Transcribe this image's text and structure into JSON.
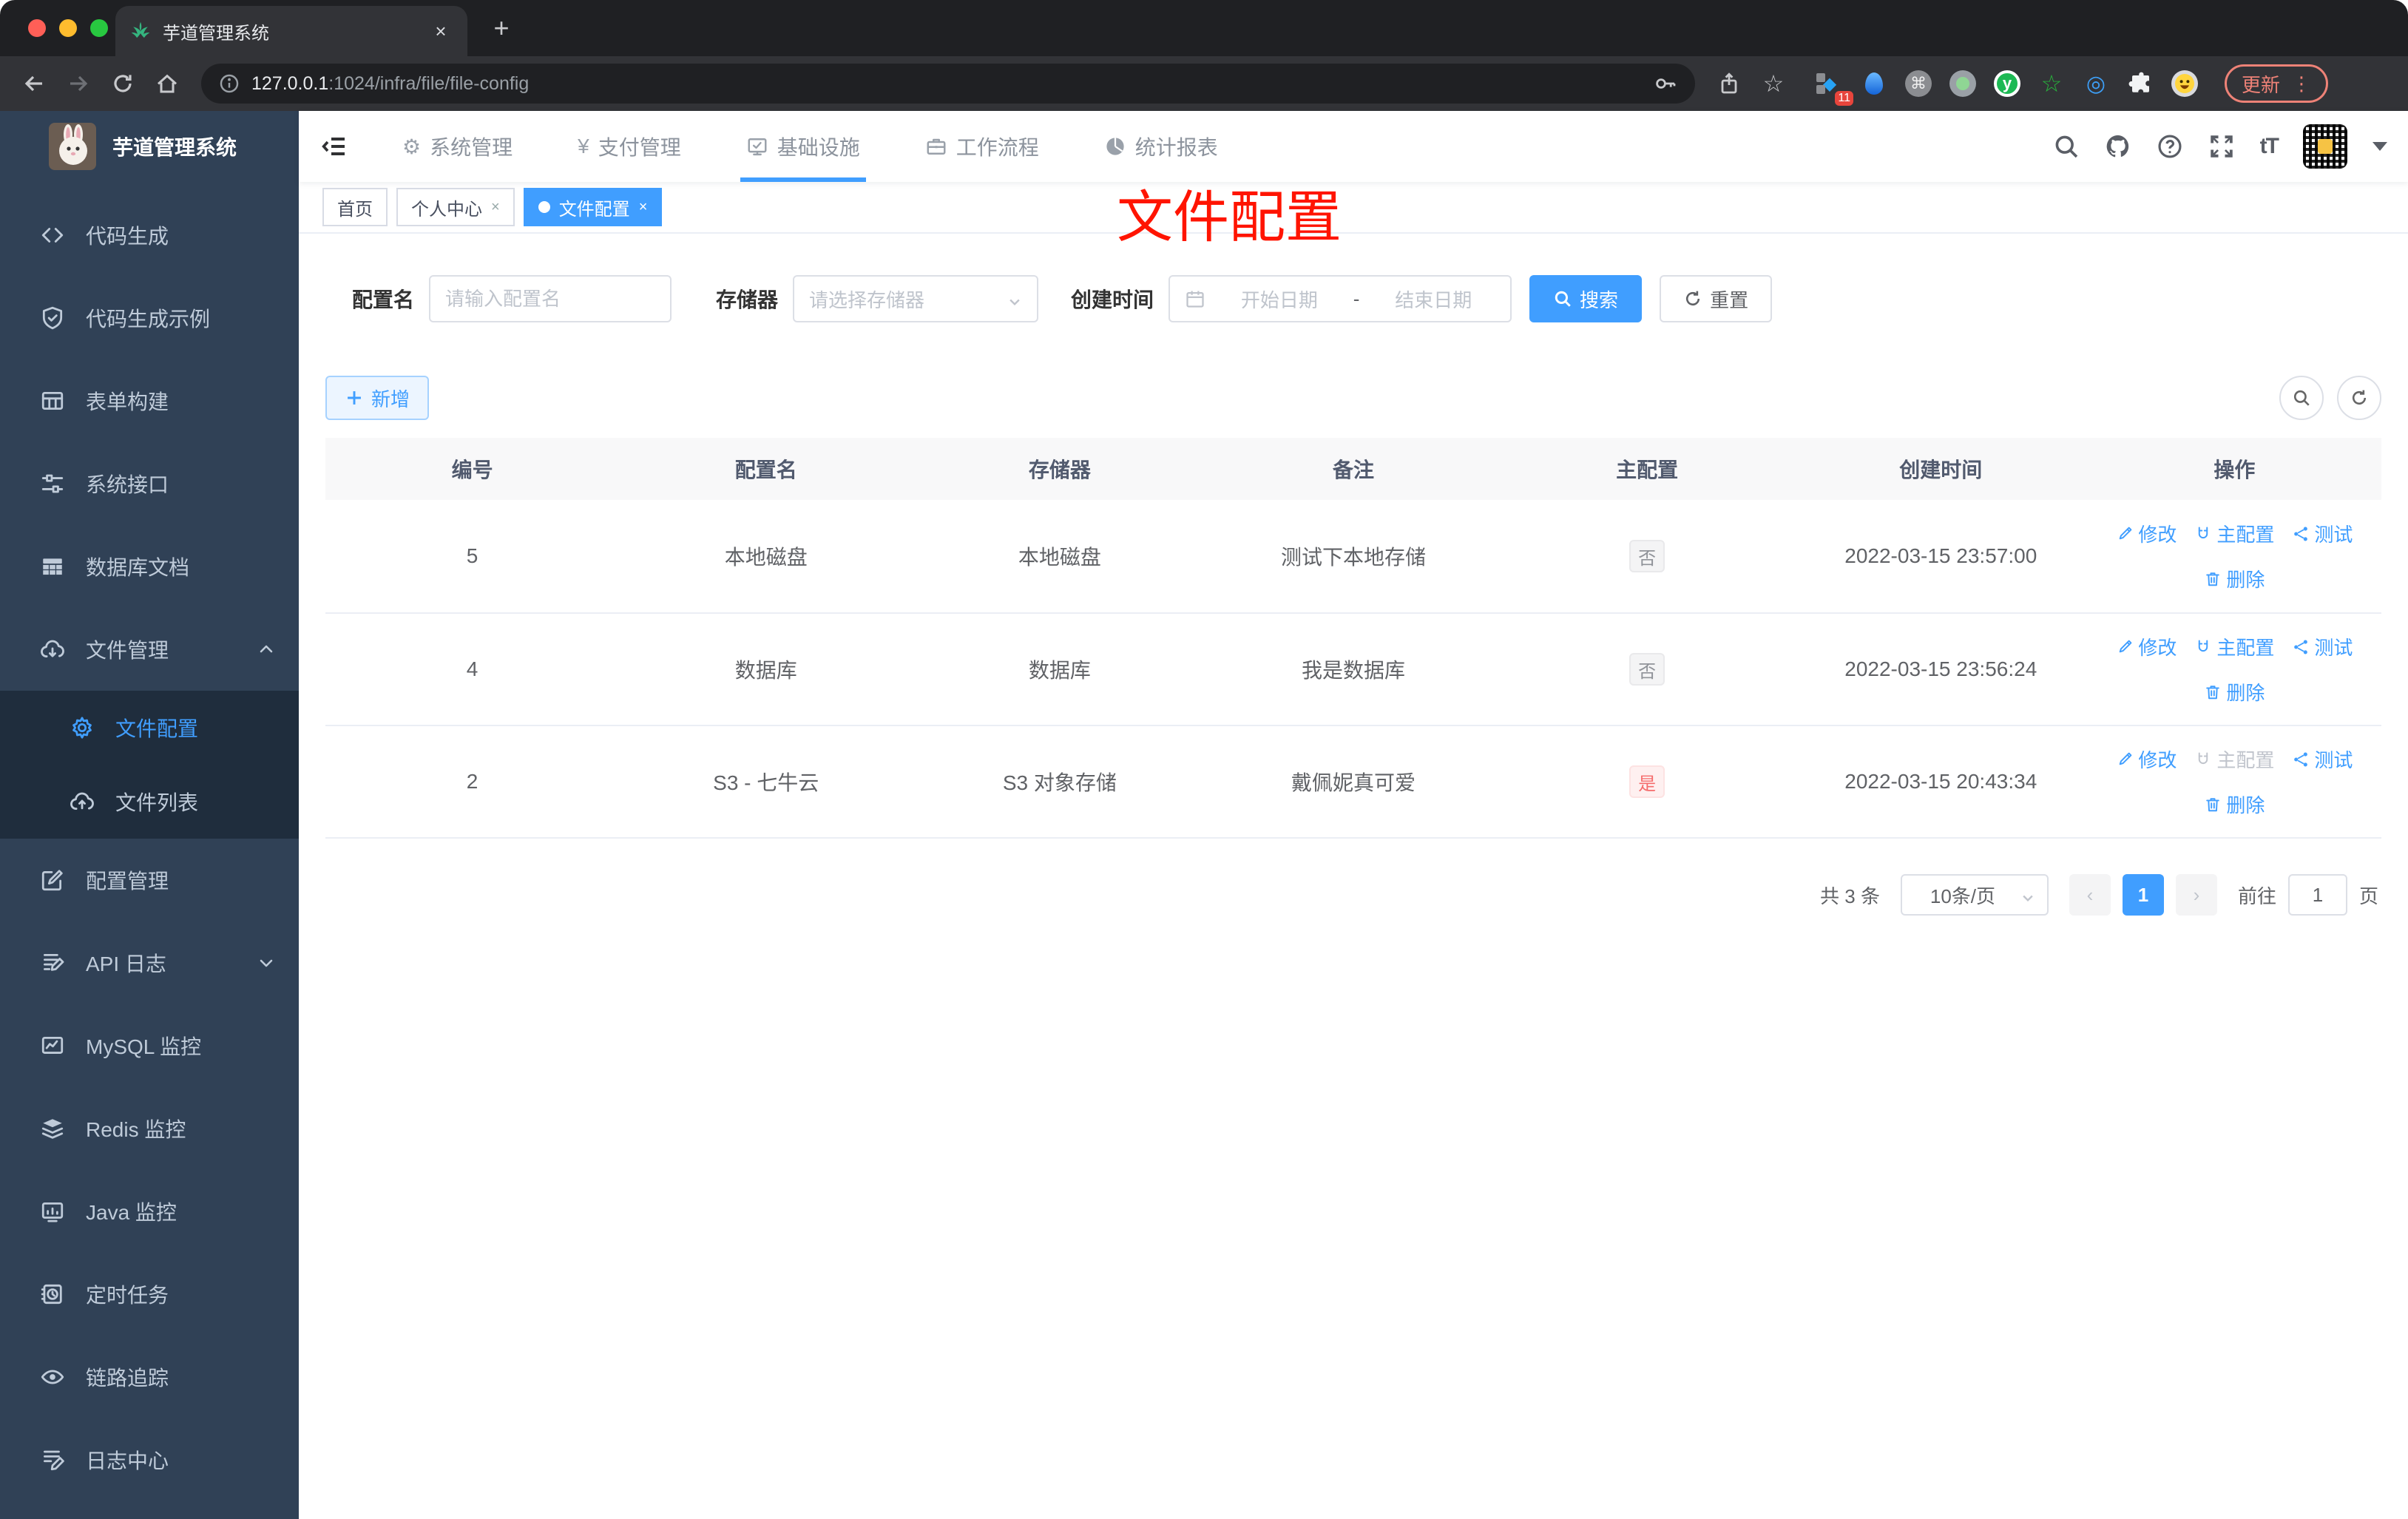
{
  "colors": {
    "accent": "#409eff",
    "title_red": "#ff1400",
    "sidebar_bg": "#304156",
    "submenu_bg": "#1f2d3d",
    "tag_info_text": "#909399",
    "tag_danger_text": "#f56c6c"
  },
  "browser": {
    "tab_title": "芋道管理系统",
    "tab_close": "×",
    "new_tab": "+",
    "url_host": "127.0.0.1",
    "url_rest": ":1024/infra/file/file-config",
    "extension_badge": "11",
    "cmd_glyph": "⌘",
    "y_glyph": "y",
    "star_glyph": "☆",
    "eye_glyph": "◎",
    "diamond_glyph": "◆",
    "update_label": "更新",
    "update_dots": "⋮"
  },
  "sidebar": {
    "title": "芋道管理系统",
    "items": [
      {
        "id": "code-gen",
        "icon": "code",
        "label": "代码生成"
      },
      {
        "id": "code-demo",
        "icon": "shield-check",
        "label": "代码生成示例"
      },
      {
        "id": "form-build",
        "icon": "grid",
        "label": "表单构建"
      },
      {
        "id": "sys-api",
        "icon": "sliders",
        "label": "系统接口"
      },
      {
        "id": "db-doc",
        "icon": "db-table",
        "label": "数据库文档"
      },
      {
        "id": "file-mgmt",
        "icon": "cloud-down",
        "label": "文件管理",
        "expanded": true,
        "children": [
          {
            "id": "file-config",
            "icon": "gear",
            "label": "文件配置",
            "active": true
          },
          {
            "id": "file-list",
            "icon": "cloud-up",
            "label": "文件列表"
          }
        ]
      },
      {
        "id": "config-mgmt",
        "icon": "edit-square",
        "label": "配置管理"
      },
      {
        "id": "api-log",
        "icon": "note-edit",
        "label": "API 日志",
        "collapsed": true
      },
      {
        "id": "mysql-monitor",
        "icon": "chart-monitor",
        "label": "MySQL 监控"
      },
      {
        "id": "redis-monitor",
        "icon": "layers",
        "label": "Redis 监控"
      },
      {
        "id": "java-monitor",
        "icon": "monitor-bars",
        "label": "Java 监控"
      },
      {
        "id": "cron-job",
        "icon": "clock-task",
        "label": "定时任务"
      },
      {
        "id": "trace",
        "icon": "eye",
        "label": "链路追踪"
      },
      {
        "id": "log-center",
        "icon": "log-edit",
        "label": "日志中心"
      }
    ]
  },
  "topnav": {
    "items": [
      {
        "id": "system",
        "icon": "gear-glyph",
        "glyph": "⚙",
        "label": "系统管理"
      },
      {
        "id": "payment",
        "icon": "yen-glyph",
        "glyph": "¥",
        "label": "支付管理"
      },
      {
        "id": "infra",
        "icon": "monitor-check",
        "label": "基础设施",
        "active": true
      },
      {
        "id": "workflow",
        "icon": "briefcase",
        "label": "工作流程"
      },
      {
        "id": "report",
        "icon": "chart-pie",
        "label": "统计报表"
      }
    ],
    "font_size_icon_label": "tT"
  },
  "tags": [
    {
      "label": "首页",
      "closable": false,
      "active": false
    },
    {
      "label": "个人中心",
      "closable": true,
      "active": false
    },
    {
      "label": "文件配置",
      "closable": true,
      "active": true
    }
  ],
  "tag_close_glyph": "×",
  "page_title": "文件配置",
  "filters": {
    "name_label": "配置名",
    "name_placeholder": "请输入配置名",
    "storage_label": "存储器",
    "storage_placeholder": "请选择存储器",
    "time_label": "创建时间",
    "start_placeholder": "开始日期",
    "range_separator": "-",
    "end_placeholder": "结束日期",
    "search_label": "搜索",
    "reset_label": "重置"
  },
  "toolbar": {
    "add_label": "新增"
  },
  "table": {
    "headers": [
      "编号",
      "配置名",
      "存储器",
      "备注",
      "主配置",
      "创建时间",
      "操作"
    ],
    "rows": [
      {
        "id": "5",
        "name": "本地磁盘",
        "storage": "本地磁盘",
        "remark": "测试下本地存储",
        "master": "否",
        "master_type": "info",
        "created": "2022-03-15 23:57:00",
        "actions": [
          {
            "label": "修改",
            "icon": "pencil",
            "disabled": false
          },
          {
            "label": "主配置",
            "icon": "magnet",
            "disabled": false
          },
          {
            "label": "测试",
            "icon": "share",
            "disabled": false
          },
          {
            "label": "删除",
            "icon": "trash",
            "disabled": false
          }
        ]
      },
      {
        "id": "4",
        "name": "数据库",
        "storage": "数据库",
        "remark": "我是数据库",
        "master": "否",
        "master_type": "info",
        "created": "2022-03-15 23:56:24",
        "actions": [
          {
            "label": "修改",
            "icon": "pencil",
            "disabled": false
          },
          {
            "label": "主配置",
            "icon": "magnet",
            "disabled": false
          },
          {
            "label": "测试",
            "icon": "share",
            "disabled": false
          },
          {
            "label": "删除",
            "icon": "trash",
            "disabled": false
          }
        ]
      },
      {
        "id": "2",
        "name": "S3 - 七牛云",
        "storage": "S3 对象存储",
        "remark": "戴佩妮真可爱",
        "master": "是",
        "master_type": "danger",
        "created": "2022-03-15 20:43:34",
        "actions": [
          {
            "label": "修改",
            "icon": "pencil",
            "disabled": false
          },
          {
            "label": "主配置",
            "icon": "magnet",
            "disabled": true
          },
          {
            "label": "测试",
            "icon": "share",
            "disabled": false
          },
          {
            "label": "删除",
            "icon": "trash",
            "disabled": false
          }
        ]
      }
    ]
  },
  "pagination": {
    "total": "共 3 条",
    "page_size": "10条/页",
    "prev": "‹",
    "page": "1",
    "next": "›",
    "goto_prefix": "前往",
    "goto_value": "1",
    "goto_suffix": "页"
  }
}
